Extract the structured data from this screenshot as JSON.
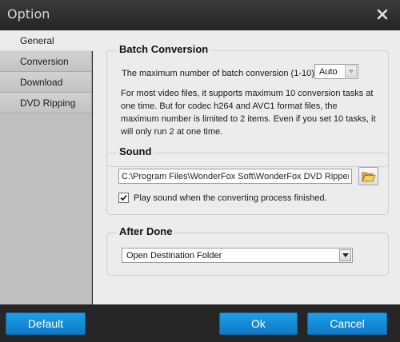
{
  "window": {
    "title": "Option",
    "close_icon": "close-icon"
  },
  "sidebar": {
    "items": [
      {
        "label": "General",
        "active": true
      },
      {
        "label": "Conversion",
        "active": false
      },
      {
        "label": "Download",
        "active": false
      },
      {
        "label": "DVD Ripping",
        "active": false
      }
    ]
  },
  "batch": {
    "title": "Batch Conversion",
    "max_label": "The maximum number of batch conversion (1-10) :",
    "max_value": "Auto",
    "description": "For most video files, it supports maximum 10 conversion tasks at one time. But for codec h264 and AVC1 format files, the maximum number is limited to 2 items. Even if you set 10 tasks, it will only run 2 at one time."
  },
  "sound": {
    "title": "Sound",
    "path": "C:\\Program Files\\WonderFox Soft\\WonderFox DVD Ripper Sp",
    "folder_icon": "folder-open-icon",
    "play_checked": true,
    "play_label": "Play sound when the converting process finished."
  },
  "after_done": {
    "title": "After Done",
    "value": "Open Destination Folder"
  },
  "buttons": {
    "default": "Default",
    "ok": "Ok",
    "cancel": "Cancel"
  },
  "colors": {
    "titlebar": "#2b2b2b",
    "accent_button": "#1589d6",
    "sidebar": "#bfbfbf",
    "content_bg": "#ececec"
  }
}
